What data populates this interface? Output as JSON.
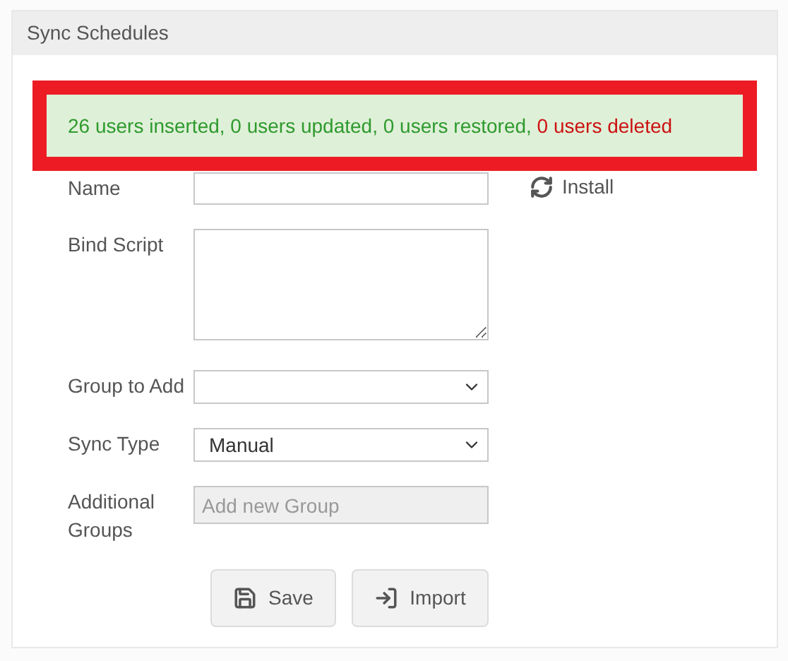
{
  "panel": {
    "title": "Sync Schedules"
  },
  "alert": {
    "parts": [
      {
        "text": "26 users inserted, 0 users updated, 0 users restored, ",
        "color": "#2e9a2e"
      },
      {
        "text": "0 users deleted",
        "color": "#cc1111"
      }
    ]
  },
  "form": {
    "fields": [
      {
        "kind": "text",
        "label": "Name"
      },
      {
        "kind": "textarea",
        "label": "Bind Script"
      },
      {
        "kind": "select",
        "label": "Group to Add"
      },
      {
        "kind": "select",
        "label": "Sync Type",
        "value": "Manual"
      },
      {
        "kind": "tags",
        "label": "Additional Groups",
        "placeholder": "Add new Group",
        "disabled": true
      }
    ],
    "install": "Install",
    "buttons": [
      {
        "label": "Save",
        "kind": "save"
      },
      {
        "label": "Import",
        "kind": "import"
      }
    ]
  }
}
